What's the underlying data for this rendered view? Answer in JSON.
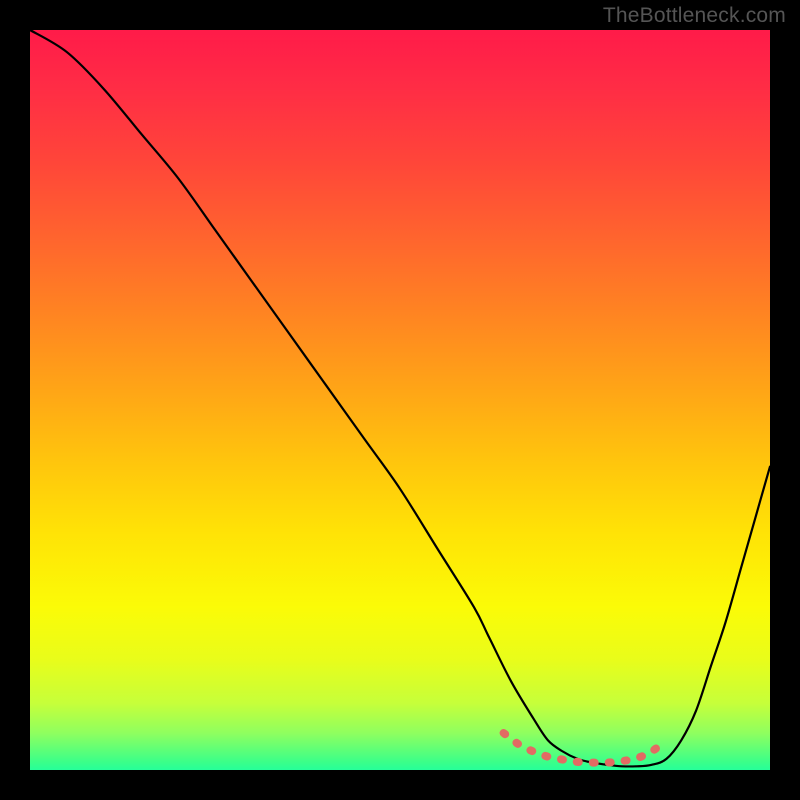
{
  "watermark": "TheBottleneck.com",
  "chart_data": {
    "type": "line",
    "title": "",
    "xlabel": "",
    "ylabel": "",
    "xlim": [
      0,
      100
    ],
    "ylim": [
      0,
      100
    ],
    "grid": false,
    "legend": false,
    "series": [
      {
        "name": "curve",
        "color": "#000000",
        "x": [
          0,
          5,
          10,
          15,
          20,
          25,
          30,
          35,
          40,
          45,
          50,
          55,
          60,
          62,
          65,
          68,
          70,
          72,
          74,
          76,
          78,
          80,
          82,
          84,
          86,
          88,
          90,
          92,
          94,
          96,
          98,
          100
        ],
        "y": [
          100,
          97,
          92,
          86,
          80,
          73,
          66,
          59,
          52,
          45,
          38,
          30,
          22,
          18,
          12,
          7,
          4,
          2.5,
          1.5,
          1,
          0.7,
          0.5,
          0.5,
          0.7,
          1.5,
          4,
          8,
          14,
          20,
          27,
          34,
          41
        ]
      }
    ],
    "valley_marker": {
      "color": "#e26b63",
      "x": [
        64,
        66,
        68,
        70,
        72,
        74,
        76,
        78,
        80,
        82,
        84,
        86
      ],
      "y": [
        5,
        3.5,
        2.5,
        1.8,
        1.4,
        1.1,
        1,
        1,
        1.2,
        1.6,
        2.5,
        4
      ]
    },
    "background_gradient": {
      "top": "#ff1b49",
      "mid": "#ffe306",
      "bottom": "#26ff9a"
    }
  }
}
